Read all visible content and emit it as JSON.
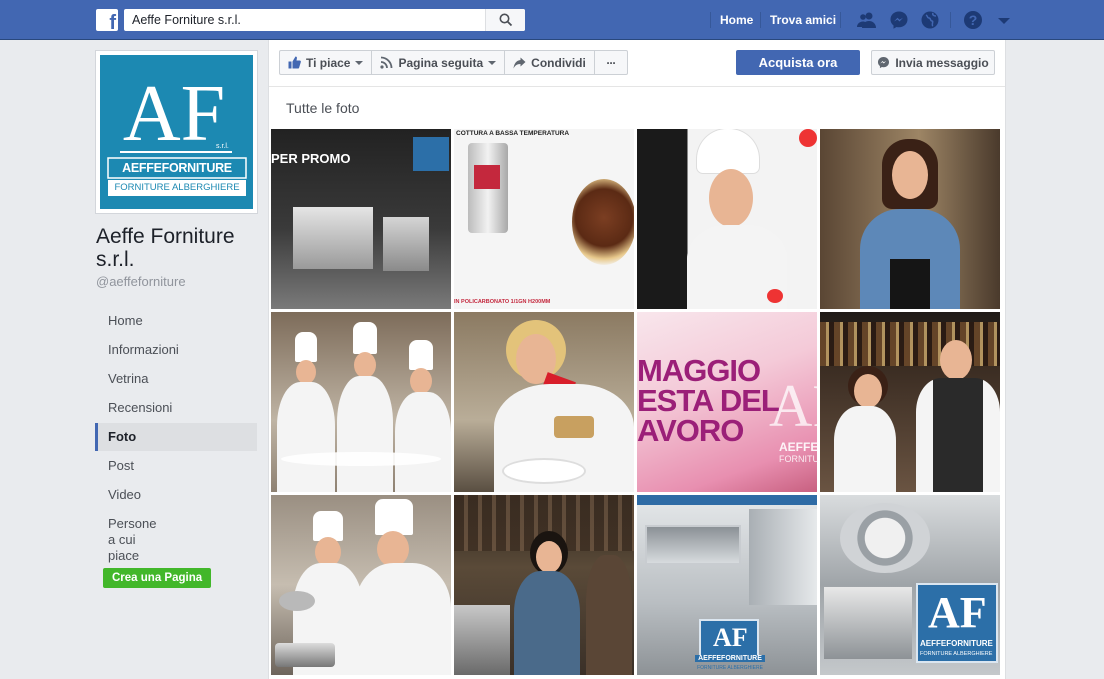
{
  "topbar": {
    "search_value": "Aeffe Forniture s.r.l.",
    "nav_home": "Home",
    "nav_find_friends": "Trova amici",
    "brand_color": "#4267b2",
    "icons": [
      "friends-icon",
      "messenger-icon",
      "notifications-globe-icon",
      "help-icon",
      "dropdown-caret-icon"
    ]
  },
  "profile": {
    "logo_letters": "AF",
    "logo_srl": "s.r.l.",
    "logo_brand": "AEFFEFORNITURE",
    "logo_tagline": "FORNITURE ALBERGHIERE",
    "name": "Aeffe Forniture s.r.l.",
    "handle": "@aeffeforniture"
  },
  "sidebar": {
    "items": [
      {
        "label": "Home"
      },
      {
        "label": "Informazioni"
      },
      {
        "label": "Vetrina"
      },
      {
        "label": "Recensioni"
      },
      {
        "label": "Foto"
      },
      {
        "label": "Post"
      },
      {
        "label": "Video"
      },
      {
        "label": "Persone a cui piace"
      }
    ],
    "active": "Foto",
    "create_page": "Crea una Pagina"
  },
  "actions": {
    "like": "Ti piace",
    "following": "Pagina seguita",
    "share": "Condividi",
    "more": "···",
    "buy": "Acquista ora",
    "message": "Invia messaggio"
  },
  "photos": {
    "title": "Tutte le foto",
    "p1_text": "PER PROMO",
    "p2_text": "COTTURA A BASSA TEMPERATURA",
    "p2_caption": "IN POLICARBONATO 1/1GN H200MM",
    "p7_line1": "MAGGIO",
    "p7_line2": "ESTA DEL",
    "p7_line3": "AVORO",
    "p7_brand": "AEFFE",
    "p7_tagline": "FORNITURE",
    "p11_brand": "AEFFEFORNITURE",
    "p11_tagline": "FORNITURE ALBERGHIERE",
    "p12_brand": "AEFFEFORNITURE",
    "p12_tagline": "FORNITURE ALBERGHIERE"
  }
}
